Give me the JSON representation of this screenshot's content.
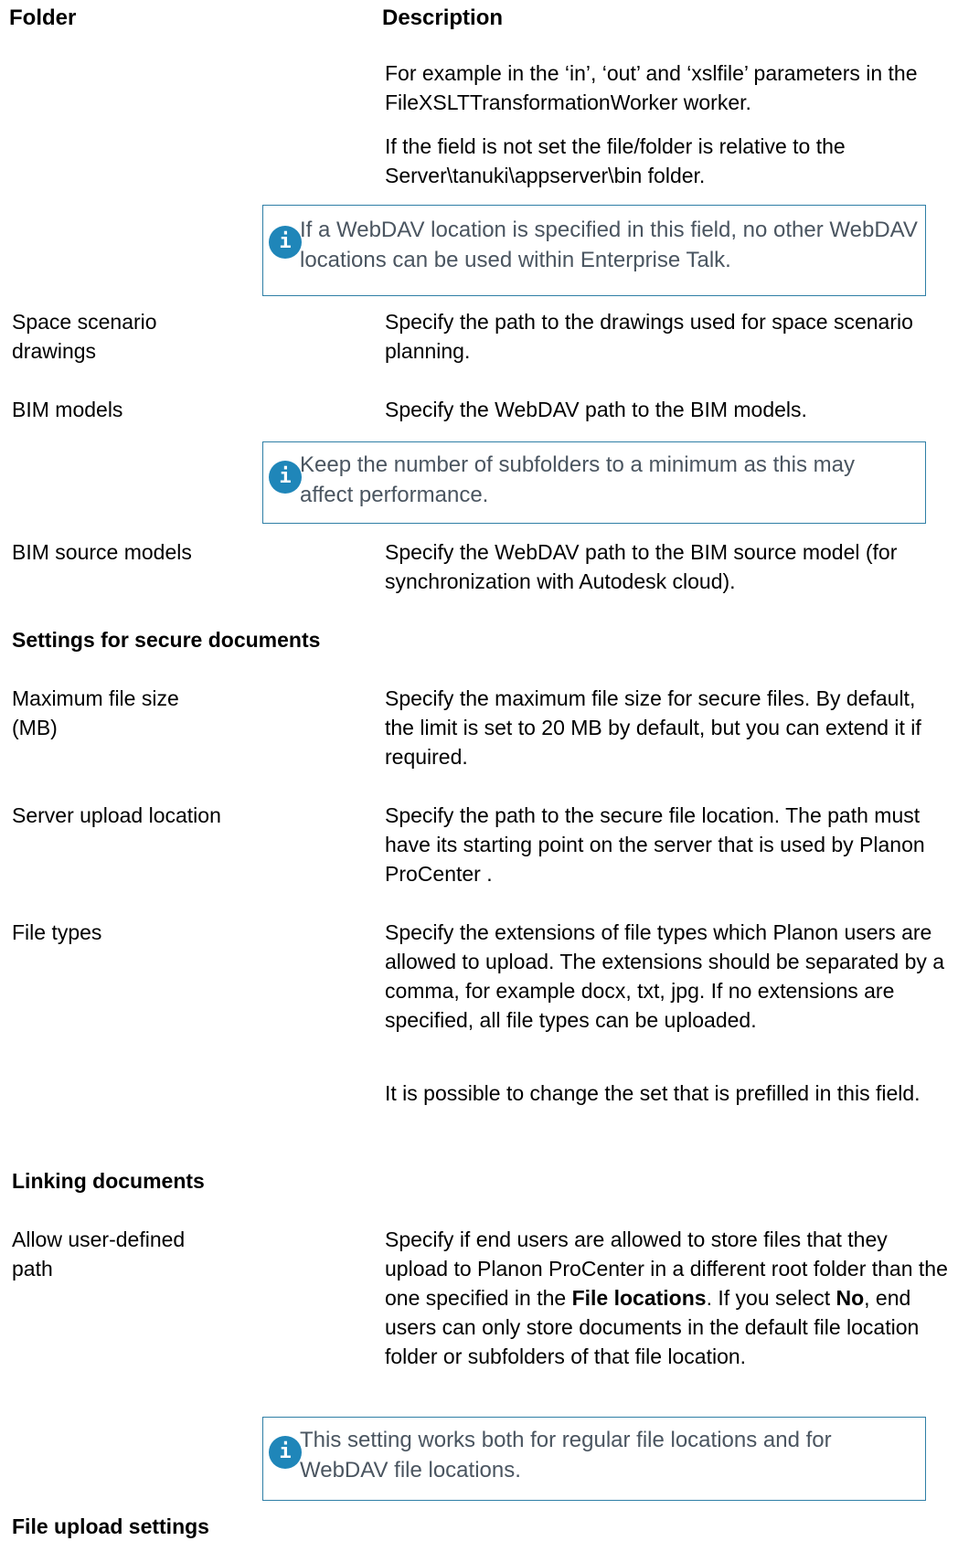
{
  "header": {
    "folder": "Folder",
    "description": "Description"
  },
  "intro": {
    "p1": "For example in the ‘in’, ‘out’ and ‘xslfile’ parameters in the FileXSLTTransformationWorker worker.",
    "p2": "If the field is not set the file/folder is relative to the Server\\tanuki\\appserver\\bin folder.",
    "note": "If a WebDAV location is specified in this field, no other WebDAV locations can be used within Enterprise Talk."
  },
  "rows": {
    "space": {
      "label": "Space scenario drawings",
      "desc": "Specify the path to the drawings used for space scenario planning."
    },
    "bim": {
      "label": "BIM models",
      "desc": "Specify the WebDAV path to the BIM models.",
      "note": "Keep the number of subfolders to a minimum as this may affect performance."
    },
    "bimsource": {
      "label": "BIM source models",
      "desc": "Specify the WebDAV path to the BIM source model (for synchronization with Autodesk cloud)."
    }
  },
  "secure": {
    "heading": "Settings for secure documents",
    "maxsize": {
      "label": "Maximum file size (MB)",
      "desc": "Specify the maximum file size for secure files. By default, the limit is set to 20 MB by default, but you can extend it if required."
    },
    "upload": {
      "label": "Server upload location",
      "desc": "Specify the path to the secure file location. The path must have its starting point on the server that is used by Planon ProCenter ."
    },
    "filetypes": {
      "label": "File types",
      "desc": "Specify the extensions of file types which Planon users are allowed to upload. The extensions should be separated by a comma, for example docx, txt, jpg. If no extensions are specified, all file types can be uploaded.",
      "desc2": "It is possible to change the set that is prefilled in this field."
    }
  },
  "linking": {
    "heading": "Linking documents",
    "allow": {
      "label": "Allow user-defined path",
      "desc_a": "Specify if end users are allowed to store files that they upload to Planon ProCenter in a different root folder than the one specified in the ",
      "desc_b": "File locations",
      "desc_c": ". If you select ",
      "desc_d": "No",
      "desc_e": ", end users can only store documents in the default file location folder or subfolders of that file location.",
      "note": "This setting works both for regular file locations and for WebDAV file locations."
    }
  },
  "upload_settings": {
    "heading": "File upload settings"
  },
  "icons": {
    "note_icon": "info-icon",
    "note_glyph": "i"
  },
  "colors": {
    "note_border": "#2f7fa6",
    "icon_bg": "#1f86b9",
    "note_text": "#4a5560"
  }
}
